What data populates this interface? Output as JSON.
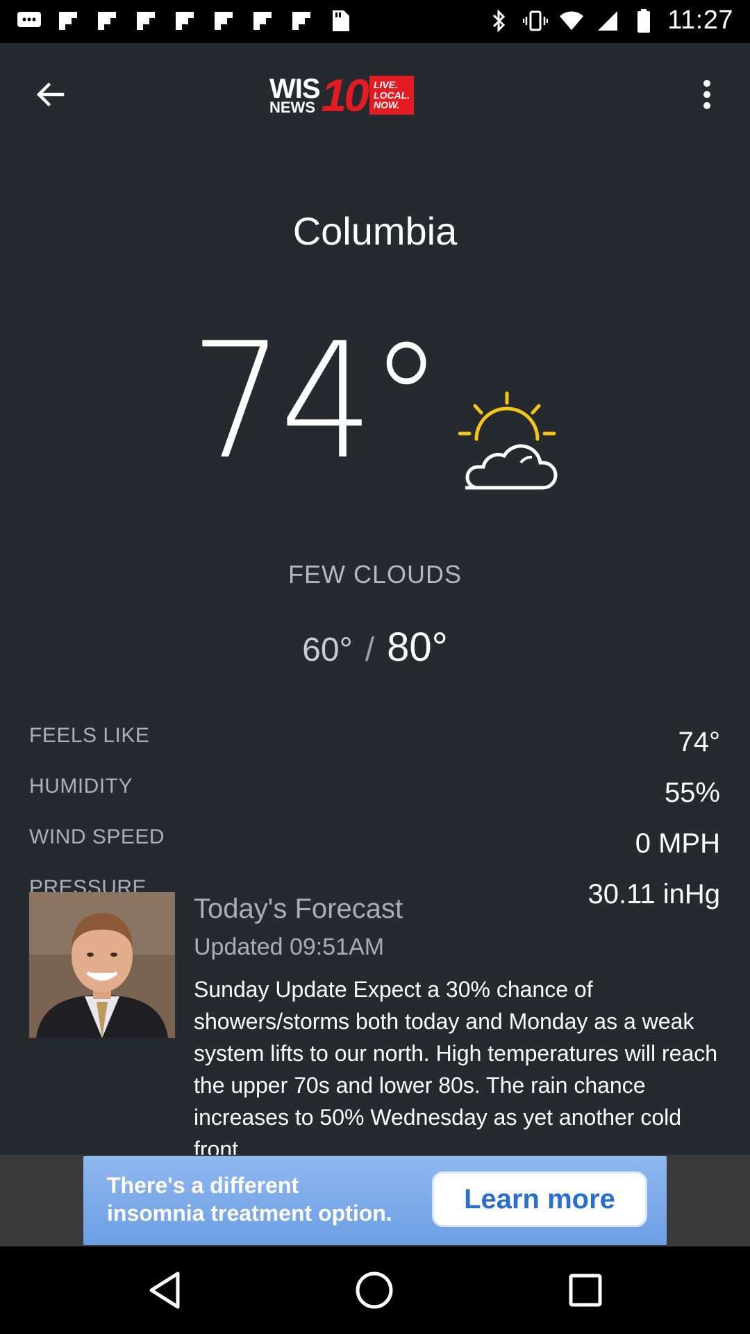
{
  "status_bar": {
    "time": "11:27",
    "left_icons": [
      "messages-icon",
      "flipboard-icon",
      "flipboard-icon",
      "flipboard-icon",
      "flipboard-icon",
      "flipboard-icon",
      "flipboard-icon",
      "flipboard-icon",
      "sd-card-icon"
    ],
    "right_icons": [
      "bluetooth-icon",
      "vibrate-icon",
      "wifi-icon",
      "signal-icon",
      "battery-icon"
    ]
  },
  "toolbar": {
    "logo": {
      "line1": "WIS",
      "line2": "NEWS",
      "number": "10",
      "tag_line1": "LIVE.",
      "tag_line2": "LOCAL.",
      "tag_line3": "NOW."
    }
  },
  "weather": {
    "city": "Columbia",
    "temperature": "74°",
    "icon": "partly-cloudy-icon",
    "condition": "FEW CLOUDS",
    "low": "60°",
    "separator": "/",
    "high": "80°",
    "details": [
      {
        "label": "FEELS LIKE",
        "value": "74°"
      },
      {
        "label": "HUMIDITY",
        "value": "55%"
      },
      {
        "label": "WIND SPEED",
        "value": "0 MPH"
      },
      {
        "label": "PRESSURE",
        "value": "30.11 inHg"
      }
    ]
  },
  "forecast": {
    "title": "Today's Forecast",
    "updated": "Updated 09:51AM",
    "body": "Sunday Update Expect a 30% chance of showers/storms both today and Monday as a weak system lifts to our north.   High temperatures will reach the upper 70s and lower 80s.  The rain chance increases to 50% Wednesday as yet another cold front"
  },
  "ad": {
    "text_line1": "There's a different",
    "text_line2": "insomnia treatment option.",
    "button": "Learn more"
  },
  "colors": {
    "background": "#252a2e",
    "accent_sun": "#f5c518",
    "brand_red": "#e31b23"
  }
}
